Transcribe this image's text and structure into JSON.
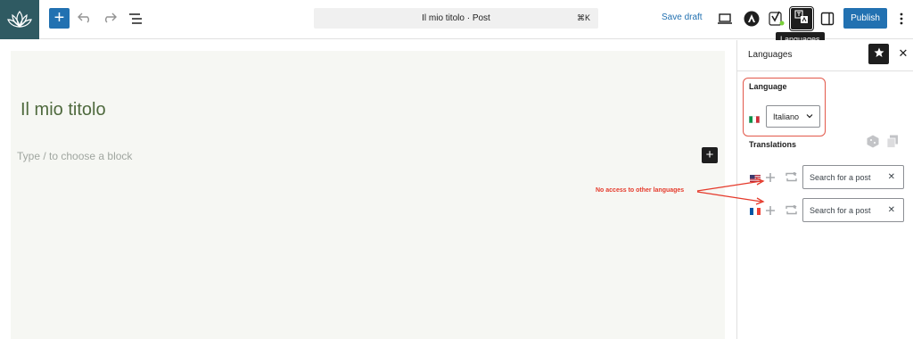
{
  "toolbar": {
    "add_label": "+",
    "doc_title": "Il mio titolo · Post",
    "shortcut": "⌘K",
    "save_draft": "Save draft",
    "publish": "Publish",
    "tooltip": "Languages",
    "icons": [
      "lotus-logo-icon",
      "undo-icon",
      "redo-icon",
      "list-view-icon",
      "preview-icon",
      "astra-icon",
      "yoast-icon",
      "languages-icon",
      "sidebar-toggle-icon",
      "more-options-icon"
    ]
  },
  "editor": {
    "post_title": "Il mio titolo",
    "block_hint": "Type / to choose a block",
    "inline_add": "+"
  },
  "sidebar": {
    "title": "Languages",
    "close": "✕",
    "language_label": "Language",
    "selected_language": "Italiano",
    "translations_label": "Translations",
    "translations": [
      {
        "flag": "us-flag-icon",
        "placeholder": "Search for a post",
        "clear": "✕"
      },
      {
        "flag": "fr-flag-icon",
        "placeholder": "Search for a post",
        "clear": "✕"
      }
    ]
  },
  "annotation": {
    "text": "No access to other languages",
    "color": "#e53a2b"
  },
  "colors": {
    "accent": "#2271b1",
    "logo_bg": "#2f5a62",
    "title_green": "#4f6a3e",
    "highlight_red": "#e2584a"
  }
}
